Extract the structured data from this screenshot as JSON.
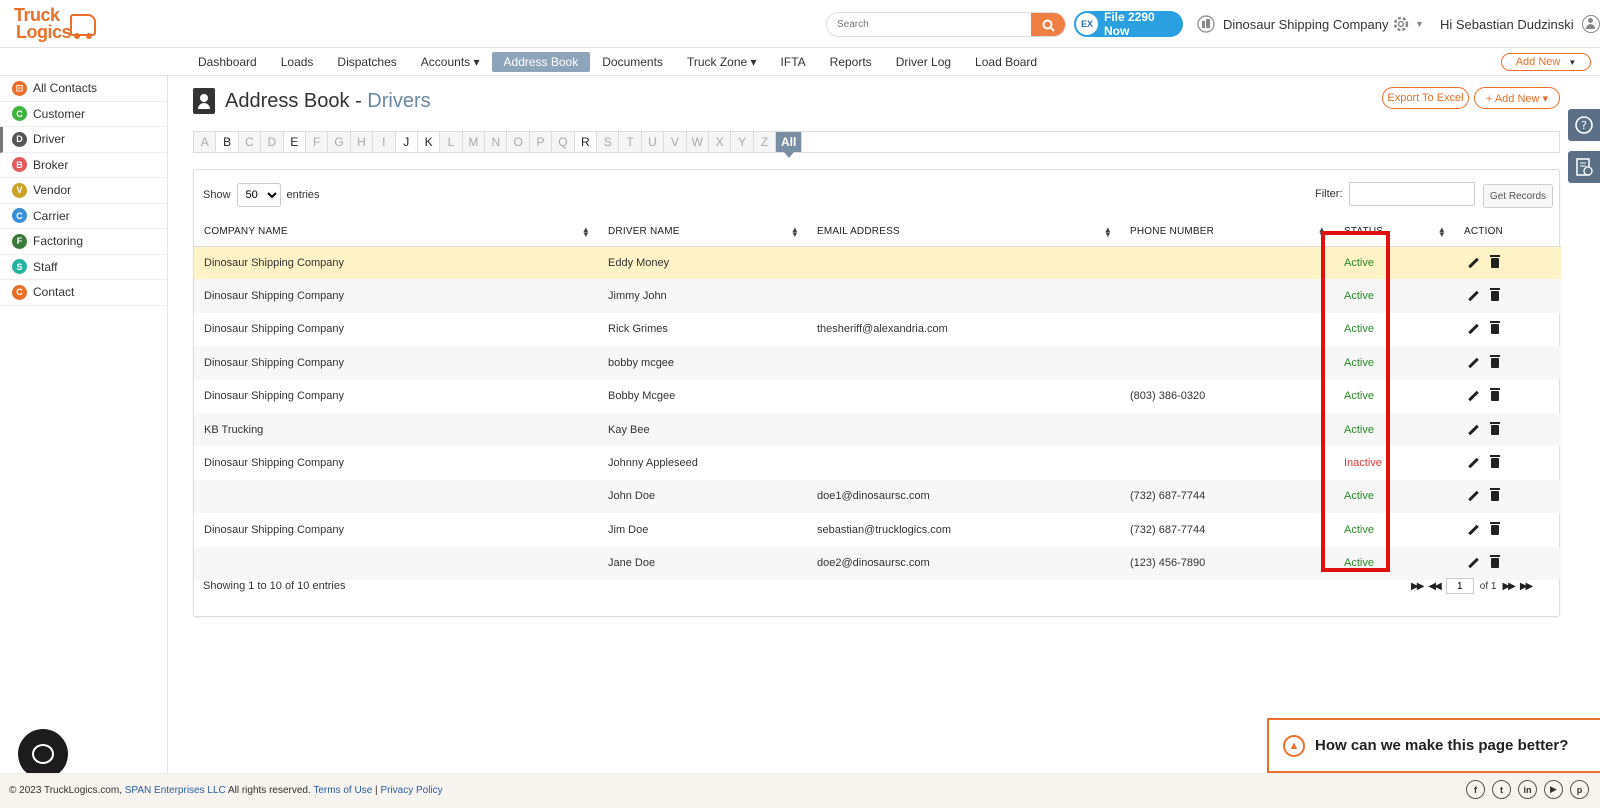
{
  "header": {
    "logo_line1": "Truck",
    "logo_line2": "Logics",
    "search_placeholder": "Search",
    "file_button": "File 2290 Now",
    "file_badge": "EX",
    "company": "Dinosaur Shipping Company",
    "greeting": "Hi Sebastian Dudzinski"
  },
  "nav": {
    "items": [
      "Dashboard",
      "Loads",
      "Dispatches",
      "Accounts ▾",
      "Address Book",
      "Documents",
      "Truck Zone ▾",
      "IFTA",
      "Reports",
      "Driver Log",
      "Load Board"
    ],
    "active": "Address Book",
    "add_new": "Add New"
  },
  "sidebar": {
    "items": [
      {
        "label": "All Contacts",
        "badge": "⊡",
        "color": "#e8702a"
      },
      {
        "label": "Customer",
        "badge": "C",
        "color": "#3fb33f"
      },
      {
        "label": "Driver",
        "badge": "D",
        "color": "#555555"
      },
      {
        "label": "Broker",
        "badge": "B",
        "color": "#e55a5a"
      },
      {
        "label": "Vendor",
        "badge": "V",
        "color": "#c9a227"
      },
      {
        "label": "Carrier",
        "badge": "C",
        "color": "#3a8fd6"
      },
      {
        "label": "Factoring",
        "badge": "F",
        "color": "#3a7a3a"
      },
      {
        "label": "Staff",
        "badge": "S",
        "color": "#26b3a0"
      },
      {
        "label": "Contact",
        "badge": "C",
        "color": "#e8702a"
      }
    ],
    "active": "Driver"
  },
  "page": {
    "title": "Address Book",
    "separator": " - ",
    "subtitle": "Drivers",
    "export_button": "Export To Excel",
    "add_new_button": "+ Add New ▾"
  },
  "alphabet": {
    "letters": [
      "A",
      "B",
      "C",
      "D",
      "E",
      "F",
      "G",
      "H",
      "I",
      "J",
      "K",
      "L",
      "M",
      "N",
      "O",
      "P",
      "Q",
      "R",
      "S",
      "T",
      "U",
      "V",
      "W",
      "X",
      "Y",
      "Z"
    ],
    "available": [
      "B",
      "E",
      "J",
      "K",
      "R"
    ],
    "all_label": "All"
  },
  "table_controls": {
    "show_label": "Show",
    "entries_value": "50",
    "entries_label": "entries",
    "filter_label": "Filter:",
    "get_records": "Get Records"
  },
  "table": {
    "columns": [
      "COMPANY NAME",
      "DRIVER NAME",
      "EMAIL ADDRESS",
      "PHONE NUMBER",
      "STATUS",
      "ACTION"
    ],
    "rows": [
      {
        "company": "Dinosaur Shipping Company",
        "driver": "Eddy Money",
        "email": "",
        "phone": "",
        "status": "Active"
      },
      {
        "company": "Dinosaur Shipping Company",
        "driver": "Jimmy John",
        "email": "",
        "phone": "",
        "status": "Active"
      },
      {
        "company": "Dinosaur Shipping Company",
        "driver": "Rick Grimes",
        "email": "thesheriff@alexandria.com",
        "phone": "",
        "status": "Active"
      },
      {
        "company": "Dinosaur Shipping Company",
        "driver": "bobby mcgee",
        "email": "",
        "phone": "",
        "status": "Active"
      },
      {
        "company": "Dinosaur Shipping Company",
        "driver": "Bobby Mcgee",
        "email": "",
        "phone": "(803) 386-0320",
        "status": "Active"
      },
      {
        "company": "KB Trucking",
        "driver": "Kay Bee",
        "email": "",
        "phone": "",
        "status": "Active"
      },
      {
        "company": "Dinosaur Shipping Company",
        "driver": "Johnny Appleseed",
        "email": "",
        "phone": "",
        "status": "Inactive"
      },
      {
        "company": "",
        "driver": "John Doe",
        "email": "doe1@dinosaursc.com",
        "phone": "(732) 687-7744",
        "status": "Active"
      },
      {
        "company": "Dinosaur Shipping Company",
        "driver": "Jim Doe",
        "email": "sebastian@trucklogics.com",
        "phone": "(732) 687-7744",
        "status": "Active"
      },
      {
        "company": "",
        "driver": "Jane Doe",
        "email": "doe2@dinosaursc.com",
        "phone": "(123) 456-7890",
        "status": "Active"
      }
    ]
  },
  "pagination": {
    "summary": "Showing 1 to 10 of 10 entries",
    "page": "1",
    "of_label": "of 1"
  },
  "feedback": {
    "text": "How can we make this page better?"
  },
  "footer": {
    "copyright": "© 2023 TruckLogics.com, ",
    "company_link": "SPAN Enterprises LLC",
    "rights": " All rights reserved. ",
    "terms": "Terms of Use",
    "divider": " | ",
    "privacy": "Privacy Policy",
    "social": [
      "f",
      "t",
      "in",
      "▶",
      "p"
    ]
  },
  "colors": {
    "brand_orange": "#e8702a",
    "active_green": "#2a8a2a",
    "inactive_red": "#d63a3a",
    "highlight_box": "#e01010"
  }
}
